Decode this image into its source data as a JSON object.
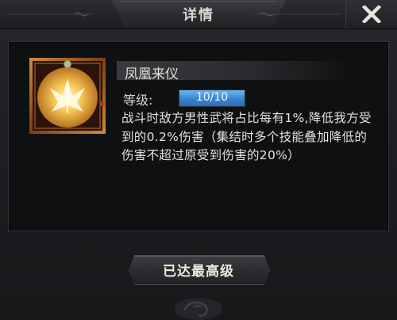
{
  "window": {
    "title": "详情",
    "close_icon": "close-x-icon"
  },
  "skill": {
    "icon": "phoenix-emblem-icon",
    "name": "凤凰来仪",
    "level_label": "等级:",
    "level_text": "10/10",
    "level_progress": 1.0,
    "description": "战斗时敌方男性武将占比每有1%,降低我方受到的0.2%伤害（集结时多个技能叠加降低的伤害不超过原受到伤害的20%）"
  },
  "footer": {
    "button_label": "已达最高级",
    "emblem_icon": "cloud-swirl-emblem-icon"
  },
  "colors": {
    "level_fill": "#3a84cf",
    "icon_gold": "#e8a93a",
    "background": "#1a1b1d"
  }
}
